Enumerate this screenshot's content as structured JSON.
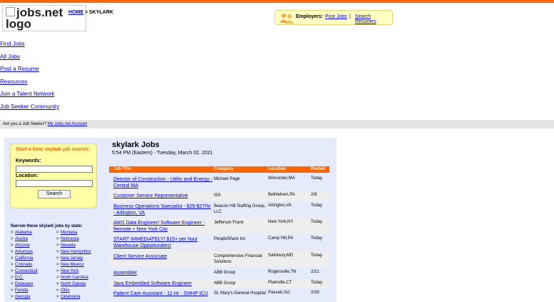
{
  "logo_alt": "jobs.net logo",
  "breadcrumb": {
    "home": "HOME",
    "sep": ">",
    "current": "SKYLARK"
  },
  "employers": {
    "label": "Employers:",
    "post_jobs": "Post Jobs",
    "sep": "|",
    "search_resumes": "Search Resumes"
  },
  "nav": [
    "Find Jobs",
    "All Jobs",
    "Post a Resume",
    "Resources",
    "Join a Talent Network",
    "Job Seeker Community"
  ],
  "seeker_bar": {
    "text": "Are you a Job Seeker?",
    "link": "My Jobs.net Account"
  },
  "search": {
    "title": "Start a New skylark job search:",
    "keywords_label": "Keywords:",
    "location_label": "Location:",
    "button": "Search"
  },
  "narrow_title": "Narrow these skylark jobs by state:",
  "states_left": [
    "Alabama",
    "Alaska",
    "Arizona",
    "Arkansas",
    "California",
    "Colorado",
    "Connecticut",
    "D.C.",
    "Delaware",
    "Florida",
    "Georgia"
  ],
  "states_right": [
    "Montana",
    "Nebraska",
    "Nevada",
    "New Hampshire",
    "New Jersey",
    "New Mexico",
    "New York",
    "North Carolina",
    "North Dakota",
    "Ohio",
    "Oklahoma"
  ],
  "page_title": "skylark Jobs",
  "date_line": "5:54 PM (Eastern) - Tuesday, March 02, 2021",
  "table": {
    "headers": [
      "Job Title",
      "Company",
      "Location",
      "Posted"
    ],
    "rows": [
      {
        "title": "Director of Construction - Utility and Energy - Central MA",
        "company": "Michael Page",
        "location": "Worcester,MA",
        "posted": "Today"
      },
      {
        "title": "Customer Service Representative",
        "company": "ISS",
        "location": "Bethlehem,PA",
        "posted": "2/8"
      },
      {
        "title": "Business Operations Specialist - $25-$27/hr - Arlington, VA",
        "company": "Beacon Hill Staffing Group, LLC",
        "location": "Arlington,VA",
        "posted": "Today"
      },
      {
        "title": "AWS Data Engineer/ Software Engineer - Remote + New York City",
        "company": "Jefferson Frank",
        "location": "New York,NY",
        "posted": "Today"
      },
      {
        "title": "START IMMEDIATELY! $15+ per hour Warehouse Opportunities!",
        "company": "PeopleShare Inc",
        "location": "Camp Hill,PA",
        "posted": "Today"
      },
      {
        "title": "Client Service Associate",
        "company": "Comprehensive Financial Solutions",
        "location": "Salisbury,MD",
        "posted": "Today"
      },
      {
        "title": "Assembler",
        "company": "ABB Group",
        "location": "Rogersville,TN",
        "posted": "2/21"
      },
      {
        "title": "Java Embedded Software Engineer",
        "company": "ABB Group",
        "location": "Plainville,CT",
        "posted": "Today"
      },
      {
        "title": "Patient Care Assistant - 12 Hr - SMHP ICU",
        "company": "St. Mary's General Hospital",
        "location": "Passaic,NJ",
        "posted": "2/28"
      }
    ]
  }
}
